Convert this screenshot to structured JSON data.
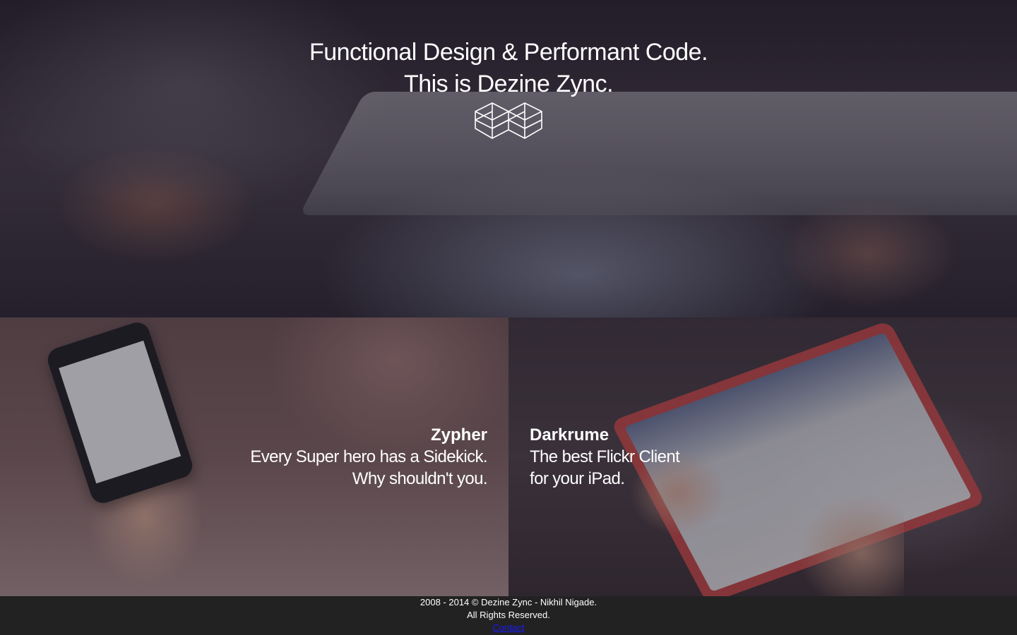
{
  "hero": {
    "title_line1": "Functional Design & Performant Code.",
    "title_line2": "This is Dezine Zync."
  },
  "projects": [
    {
      "name": "Zypher",
      "tagline_line1": "Every Super hero has a Sidekick.",
      "tagline_line2": "Why shouldn't you."
    },
    {
      "name": "Darkrume",
      "tagline_line1": "The best Flickr Client",
      "tagline_line2": "for your iPad."
    }
  ],
  "footer": {
    "copyright": "2008 - 2014 © Dezine Zync - Nikhil Nigade.",
    "rights": "All Rights Reserved.",
    "contact_link": "Contact"
  },
  "colors": {
    "text": "#ffffff",
    "footer_background": "#232223",
    "link": "#1a1aff"
  },
  "icons": {
    "logo": "wireframe-cube-logo-icon"
  }
}
